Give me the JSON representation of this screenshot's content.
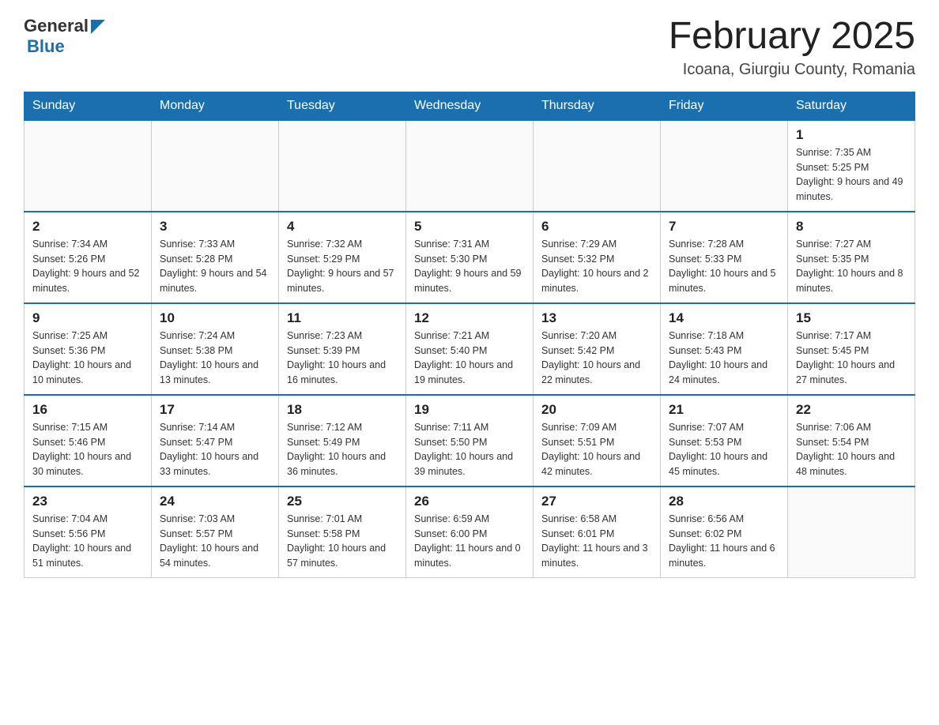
{
  "header": {
    "logo": {
      "general": "General",
      "blue": "Blue"
    },
    "title": "February 2025",
    "location": "Icoana, Giurgiu County, Romania"
  },
  "days_of_week": [
    "Sunday",
    "Monday",
    "Tuesday",
    "Wednesday",
    "Thursday",
    "Friday",
    "Saturday"
  ],
  "weeks": [
    {
      "days": [
        {
          "num": "",
          "info": ""
        },
        {
          "num": "",
          "info": ""
        },
        {
          "num": "",
          "info": ""
        },
        {
          "num": "",
          "info": ""
        },
        {
          "num": "",
          "info": ""
        },
        {
          "num": "",
          "info": ""
        },
        {
          "num": "1",
          "info": "Sunrise: 7:35 AM\nSunset: 5:25 PM\nDaylight: 9 hours and 49 minutes."
        }
      ]
    },
    {
      "days": [
        {
          "num": "2",
          "info": "Sunrise: 7:34 AM\nSunset: 5:26 PM\nDaylight: 9 hours and 52 minutes."
        },
        {
          "num": "3",
          "info": "Sunrise: 7:33 AM\nSunset: 5:28 PM\nDaylight: 9 hours and 54 minutes."
        },
        {
          "num": "4",
          "info": "Sunrise: 7:32 AM\nSunset: 5:29 PM\nDaylight: 9 hours and 57 minutes."
        },
        {
          "num": "5",
          "info": "Sunrise: 7:31 AM\nSunset: 5:30 PM\nDaylight: 9 hours and 59 minutes."
        },
        {
          "num": "6",
          "info": "Sunrise: 7:29 AM\nSunset: 5:32 PM\nDaylight: 10 hours and 2 minutes."
        },
        {
          "num": "7",
          "info": "Sunrise: 7:28 AM\nSunset: 5:33 PM\nDaylight: 10 hours and 5 minutes."
        },
        {
          "num": "8",
          "info": "Sunrise: 7:27 AM\nSunset: 5:35 PM\nDaylight: 10 hours and 8 minutes."
        }
      ]
    },
    {
      "days": [
        {
          "num": "9",
          "info": "Sunrise: 7:25 AM\nSunset: 5:36 PM\nDaylight: 10 hours and 10 minutes."
        },
        {
          "num": "10",
          "info": "Sunrise: 7:24 AM\nSunset: 5:38 PM\nDaylight: 10 hours and 13 minutes."
        },
        {
          "num": "11",
          "info": "Sunrise: 7:23 AM\nSunset: 5:39 PM\nDaylight: 10 hours and 16 minutes."
        },
        {
          "num": "12",
          "info": "Sunrise: 7:21 AM\nSunset: 5:40 PM\nDaylight: 10 hours and 19 minutes."
        },
        {
          "num": "13",
          "info": "Sunrise: 7:20 AM\nSunset: 5:42 PM\nDaylight: 10 hours and 22 minutes."
        },
        {
          "num": "14",
          "info": "Sunrise: 7:18 AM\nSunset: 5:43 PM\nDaylight: 10 hours and 24 minutes."
        },
        {
          "num": "15",
          "info": "Sunrise: 7:17 AM\nSunset: 5:45 PM\nDaylight: 10 hours and 27 minutes."
        }
      ]
    },
    {
      "days": [
        {
          "num": "16",
          "info": "Sunrise: 7:15 AM\nSunset: 5:46 PM\nDaylight: 10 hours and 30 minutes."
        },
        {
          "num": "17",
          "info": "Sunrise: 7:14 AM\nSunset: 5:47 PM\nDaylight: 10 hours and 33 minutes."
        },
        {
          "num": "18",
          "info": "Sunrise: 7:12 AM\nSunset: 5:49 PM\nDaylight: 10 hours and 36 minutes."
        },
        {
          "num": "19",
          "info": "Sunrise: 7:11 AM\nSunset: 5:50 PM\nDaylight: 10 hours and 39 minutes."
        },
        {
          "num": "20",
          "info": "Sunrise: 7:09 AM\nSunset: 5:51 PM\nDaylight: 10 hours and 42 minutes."
        },
        {
          "num": "21",
          "info": "Sunrise: 7:07 AM\nSunset: 5:53 PM\nDaylight: 10 hours and 45 minutes."
        },
        {
          "num": "22",
          "info": "Sunrise: 7:06 AM\nSunset: 5:54 PM\nDaylight: 10 hours and 48 minutes."
        }
      ]
    },
    {
      "days": [
        {
          "num": "23",
          "info": "Sunrise: 7:04 AM\nSunset: 5:56 PM\nDaylight: 10 hours and 51 minutes."
        },
        {
          "num": "24",
          "info": "Sunrise: 7:03 AM\nSunset: 5:57 PM\nDaylight: 10 hours and 54 minutes."
        },
        {
          "num": "25",
          "info": "Sunrise: 7:01 AM\nSunset: 5:58 PM\nDaylight: 10 hours and 57 minutes."
        },
        {
          "num": "26",
          "info": "Sunrise: 6:59 AM\nSunset: 6:00 PM\nDaylight: 11 hours and 0 minutes."
        },
        {
          "num": "27",
          "info": "Sunrise: 6:58 AM\nSunset: 6:01 PM\nDaylight: 11 hours and 3 minutes."
        },
        {
          "num": "28",
          "info": "Sunrise: 6:56 AM\nSunset: 6:02 PM\nDaylight: 11 hours and 6 minutes."
        },
        {
          "num": "",
          "info": ""
        }
      ]
    }
  ]
}
